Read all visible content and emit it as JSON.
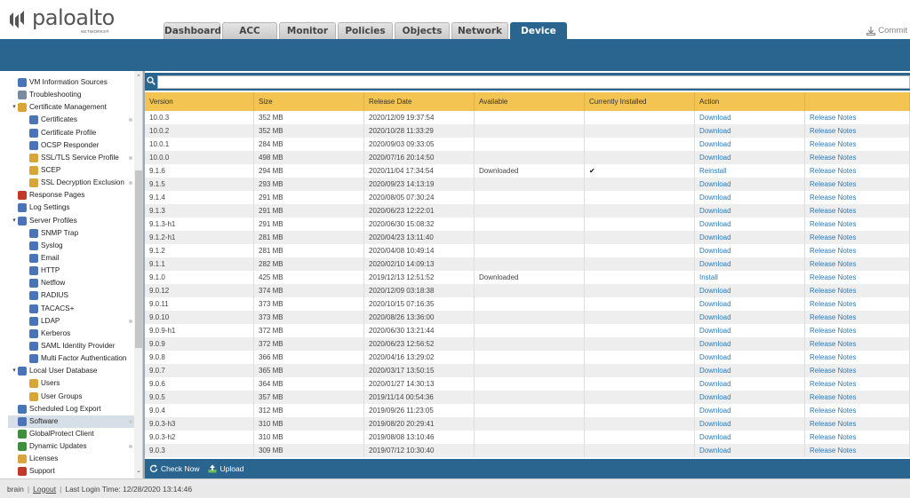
{
  "brand": {
    "name": "paloalto",
    "sub": "NETWORKS®"
  },
  "tabs": [
    "Dashboard",
    "ACC",
    "Monitor",
    "Policies",
    "Objects",
    "Network",
    "Device"
  ],
  "active_tab": "Device",
  "commit_label": "Commit",
  "nav": {
    "items": [
      {
        "label": "VM Information Sources",
        "indent": 1,
        "icon": "vm-info-icon",
        "color": "#4a74b5"
      },
      {
        "label": "Troubleshooting",
        "indent": 1,
        "icon": "wrench-icon",
        "color": "#7a8aa0"
      },
      {
        "label": "Certificate Management",
        "indent": 0,
        "icon": "certificate-folder-icon",
        "color": "#d7a53a",
        "expander": "▾"
      },
      {
        "label": "Certificates",
        "indent": 2,
        "icon": "certificate-icon",
        "color": "#4a74b5",
        "dot": true
      },
      {
        "label": "Certificate Profile",
        "indent": 2,
        "icon": "certificate-profile-icon",
        "color": "#4a74b5"
      },
      {
        "label": "OCSP Responder",
        "indent": 2,
        "icon": "ocsp-icon",
        "color": "#4a74b5"
      },
      {
        "label": "SSL/TLS Service Profile",
        "indent": 2,
        "icon": "lock-icon",
        "color": "#d7a53a",
        "dot": true
      },
      {
        "label": "SCEP",
        "indent": 2,
        "icon": "lock-icon",
        "color": "#d7a53a"
      },
      {
        "label": "SSL Decryption Exclusion",
        "indent": 2,
        "icon": "lock-icon",
        "color": "#d7a53a",
        "dot": true
      },
      {
        "label": "Response Pages",
        "indent": 1,
        "icon": "response-pages-icon",
        "color": "#c0392b"
      },
      {
        "label": "Log Settings",
        "indent": 1,
        "icon": "log-settings-icon",
        "color": "#4a74b5"
      },
      {
        "label": "Server Profiles",
        "indent": 0,
        "icon": "server-profiles-icon",
        "color": "#4a74b5",
        "expander": "▾"
      },
      {
        "label": "SNMP Trap",
        "indent": 2,
        "icon": "server-icon",
        "color": "#4a74b5"
      },
      {
        "label": "Syslog",
        "indent": 2,
        "icon": "server-icon",
        "color": "#4a74b5"
      },
      {
        "label": "Email",
        "indent": 2,
        "icon": "server-icon",
        "color": "#4a74b5"
      },
      {
        "label": "HTTP",
        "indent": 2,
        "icon": "server-icon",
        "color": "#4a74b5"
      },
      {
        "label": "Netflow",
        "indent": 2,
        "icon": "server-icon",
        "color": "#4a74b5"
      },
      {
        "label": "RADIUS",
        "indent": 2,
        "icon": "server-icon",
        "color": "#4a74b5"
      },
      {
        "label": "TACACS+",
        "indent": 2,
        "icon": "server-icon",
        "color": "#4a74b5"
      },
      {
        "label": "LDAP",
        "indent": 2,
        "icon": "server-icon",
        "color": "#4a74b5",
        "dot": true
      },
      {
        "label": "Kerberos",
        "indent": 2,
        "icon": "server-icon",
        "color": "#4a74b5"
      },
      {
        "label": "SAML Identity Provider",
        "indent": 2,
        "icon": "server-icon",
        "color": "#4a74b5"
      },
      {
        "label": "Multi Factor Authentication",
        "indent": 2,
        "icon": "server-icon",
        "color": "#4a74b5"
      },
      {
        "label": "Local User Database",
        "indent": 0,
        "icon": "user-database-icon",
        "color": "#4a74b5",
        "expander": "▾"
      },
      {
        "label": "Users",
        "indent": 2,
        "icon": "user-icon",
        "color": "#d7a53a"
      },
      {
        "label": "User Groups",
        "indent": 2,
        "icon": "user-group-icon",
        "color": "#d7a53a"
      },
      {
        "label": "Scheduled Log Export",
        "indent": 1,
        "icon": "scheduled-export-icon",
        "color": "#4a74b5"
      },
      {
        "label": "Software",
        "indent": 1,
        "icon": "software-icon",
        "color": "#4a74b5",
        "dot": true,
        "selected": true
      },
      {
        "label": "GlobalProtect Client",
        "indent": 1,
        "icon": "globalprotect-icon",
        "color": "#3d8f3d"
      },
      {
        "label": "Dynamic Updates",
        "indent": 1,
        "icon": "dynamic-updates-icon",
        "color": "#3d8f3d",
        "dot": true
      },
      {
        "label": "Licenses",
        "indent": 1,
        "icon": "license-icon",
        "color": "#d7a53a"
      },
      {
        "label": "Support",
        "indent": 1,
        "icon": "support-icon",
        "color": "#c0392b"
      }
    ]
  },
  "search": {
    "placeholder": ""
  },
  "table": {
    "headers": [
      "Version",
      "Size",
      "Release Date",
      "Available",
      "Currently Installed",
      "Action",
      ""
    ],
    "rows": [
      [
        "10.0.3",
        "352 MB",
        "2020/12/09 19:37:54",
        "",
        "",
        "Download",
        "Release Notes"
      ],
      [
        "10.0.2",
        "352 MB",
        "2020/10/28 11:33:29",
        "",
        "",
        "Download",
        "Release Notes"
      ],
      [
        "10.0.1",
        "284 MB",
        "2020/09/03 09:33:05",
        "",
        "",
        "Download",
        "Release Notes"
      ],
      [
        "10.0.0",
        "498 MB",
        "2020/07/16 20:14:50",
        "",
        "",
        "Download",
        "Release Notes"
      ],
      [
        "9.1.6",
        "294 MB",
        "2020/11/04 17:34:54",
        "Downloaded",
        "✔",
        "Reinstall",
        "Release Notes"
      ],
      [
        "9.1.5",
        "293 MB",
        "2020/09/23 14:13:19",
        "",
        "",
        "Download",
        "Release Notes"
      ],
      [
        "9.1.4",
        "291 MB",
        "2020/08/05 07:30:24",
        "",
        "",
        "Download",
        "Release Notes"
      ],
      [
        "9.1.3",
        "291 MB",
        "2020/06/23 12:22:01",
        "",
        "",
        "Download",
        "Release Notes"
      ],
      [
        "9.1.3-h1",
        "291 MB",
        "2020/06/30 15:08:32",
        "",
        "",
        "Download",
        "Release Notes"
      ],
      [
        "9.1.2-h1",
        "281 MB",
        "2020/04/23 13:11:40",
        "",
        "",
        "Download",
        "Release Notes"
      ],
      [
        "9.1.2",
        "281 MB",
        "2020/04/08 10:49:14",
        "",
        "",
        "Download",
        "Release Notes"
      ],
      [
        "9.1.1",
        "282 MB",
        "2020/02/10 14:09:13",
        "",
        "",
        "Download",
        "Release Notes"
      ],
      [
        "9.1.0",
        "425 MB",
        "2019/12/13 12:51:52",
        "Downloaded",
        "",
        "Install",
        "Release Notes"
      ],
      [
        "9.0.12",
        "374 MB",
        "2020/12/09 03:18:38",
        "",
        "",
        "Download",
        "Release Notes"
      ],
      [
        "9.0.11",
        "373 MB",
        "2020/10/15 07:16:35",
        "",
        "",
        "Download",
        "Release Notes"
      ],
      [
        "9.0.10",
        "373 MB",
        "2020/08/26 13:36:00",
        "",
        "",
        "Download",
        "Release Notes"
      ],
      [
        "9.0.9-h1",
        "372 MB",
        "2020/06/30 13:21:44",
        "",
        "",
        "Download",
        "Release Notes"
      ],
      [
        "9.0.9",
        "372 MB",
        "2020/06/23 12:56:52",
        "",
        "",
        "Download",
        "Release Notes"
      ],
      [
        "9.0.8",
        "366 MB",
        "2020/04/16 13:29:02",
        "",
        "",
        "Download",
        "Release Notes"
      ],
      [
        "9.0.7",
        "365 MB",
        "2020/03/17 13:50:15",
        "",
        "",
        "Download",
        "Release Notes"
      ],
      [
        "9.0.6",
        "364 MB",
        "2020/01/27 14:30:13",
        "",
        "",
        "Download",
        "Release Notes"
      ],
      [
        "9.0.5",
        "357 MB",
        "2019/11/14 00:54:36",
        "",
        "",
        "Download",
        "Release Notes"
      ],
      [
        "9.0.4",
        "312 MB",
        "2019/09/26 11:23:05",
        "",
        "",
        "Download",
        "Release Notes"
      ],
      [
        "9.0.3-h3",
        "310 MB",
        "2019/08/20 20:29:41",
        "",
        "",
        "Download",
        "Release Notes"
      ],
      [
        "9.0.3-h2",
        "310 MB",
        "2019/08/08 13:10:46",
        "",
        "",
        "Download",
        "Release Notes"
      ],
      [
        "9.0.3",
        "309 MB",
        "2019/07/12 10:30:40",
        "",
        "",
        "Download",
        "Release Notes"
      ]
    ]
  },
  "toolbar": {
    "check_now": "Check Now",
    "upload": "Upload"
  },
  "footer": {
    "user": "brain",
    "logout": "Logout",
    "last_login": "Last Login Time: 12/28/2020 13:14:46"
  },
  "colors": {
    "accent": "#2a6590",
    "header_row": "#f3c452",
    "link": "#2a7ab8"
  }
}
